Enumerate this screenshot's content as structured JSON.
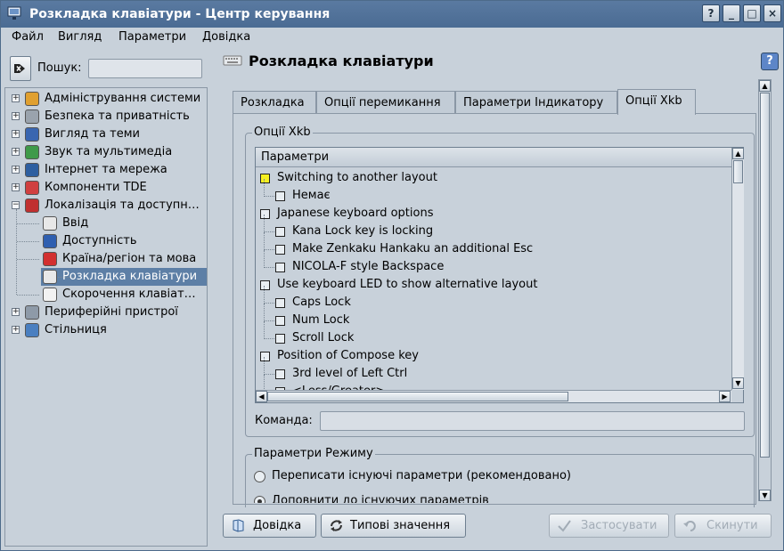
{
  "window": {
    "title": "Розкладка клавіатури - Центр керування",
    "controls": [
      "?",
      "_",
      "□",
      "×"
    ]
  },
  "menu": [
    "Файл",
    "Вигляд",
    "Параметри",
    "Довідка"
  ],
  "search": {
    "label": "Пошук:",
    "value": ""
  },
  "tree": [
    {
      "label": "Адміністрування системи",
      "icon": "admin-icon",
      "expanded": false
    },
    {
      "label": "Безпека та приватність",
      "icon": "security-icon",
      "expanded": false
    },
    {
      "label": "Вигляд та теми",
      "icon": "appearance-icon",
      "expanded": false
    },
    {
      "label": "Звук та мультимедіа",
      "icon": "sound-icon",
      "expanded": false
    },
    {
      "label": "Інтернет та мережа",
      "icon": "network-icon",
      "expanded": false
    },
    {
      "label": "Компоненти TDE",
      "icon": "components-icon",
      "expanded": false
    },
    {
      "label": "Локалізація та доступн…",
      "icon": "localization-icon",
      "expanded": true
    },
    {
      "label": "Ввід",
      "icon": "keyboard-icon",
      "child": true
    },
    {
      "label": "Доступність",
      "icon": "accessibility-icon",
      "child": true
    },
    {
      "label": "Країна/регіон та мова",
      "icon": "flag-icon",
      "child": true
    },
    {
      "label": "Розкладка клавіатури",
      "icon": "keyboard-layout-icon",
      "child": true,
      "selected": true
    },
    {
      "label": "Скорочення клавіат…",
      "icon": "shortcuts-icon",
      "child": true
    },
    {
      "label": "Периферійні пристрої",
      "icon": "peripherals-icon",
      "expanded": false
    },
    {
      "label": "Стільниця",
      "icon": "desktop-icon",
      "expanded": false
    }
  ],
  "page_title": "Розкладка клавіатури",
  "tabs": [
    "Розкладка",
    "Опції перемикання",
    "Параметри Індикатору",
    "Опції Xkb"
  ],
  "active_tab": 3,
  "xkb_group_label": "Опції Xkb",
  "list_header": "Параметри",
  "options": [
    {
      "label": "Switching to another layout",
      "level": 0,
      "yellow": true
    },
    {
      "label": "Немає",
      "level": 1
    },
    {
      "label": "Japanese keyboard options",
      "level": 0
    },
    {
      "label": "Kana Lock key is locking",
      "level": 1
    },
    {
      "label": "Make Zenkaku Hankaku an additional Esc",
      "level": 1
    },
    {
      "label": "NICOLA-F style Backspace",
      "level": 1
    },
    {
      "label": "Use keyboard LED to show alternative layout",
      "level": 0
    },
    {
      "label": "Caps Lock",
      "level": 1
    },
    {
      "label": "Num Lock",
      "level": 1
    },
    {
      "label": "Scroll Lock",
      "level": 1
    },
    {
      "label": "Position of Compose key",
      "level": 0
    },
    {
      "label": "3rd level of Left Ctrl",
      "level": 1
    },
    {
      "label": "<Less/Greater>",
      "level": 1
    }
  ],
  "command": {
    "label": "Команда:",
    "value": ""
  },
  "mode_group": {
    "label": "Параметри Режиму",
    "options": [
      "Переписати існуючі параметри (рекомендовано)",
      "Доповнити до існуючих параметрів"
    ],
    "selected": 1
  },
  "buttons": {
    "help": "Довідка",
    "defaults": "Типові значення",
    "apply": "Застосувати",
    "reset": "Скинути"
  }
}
